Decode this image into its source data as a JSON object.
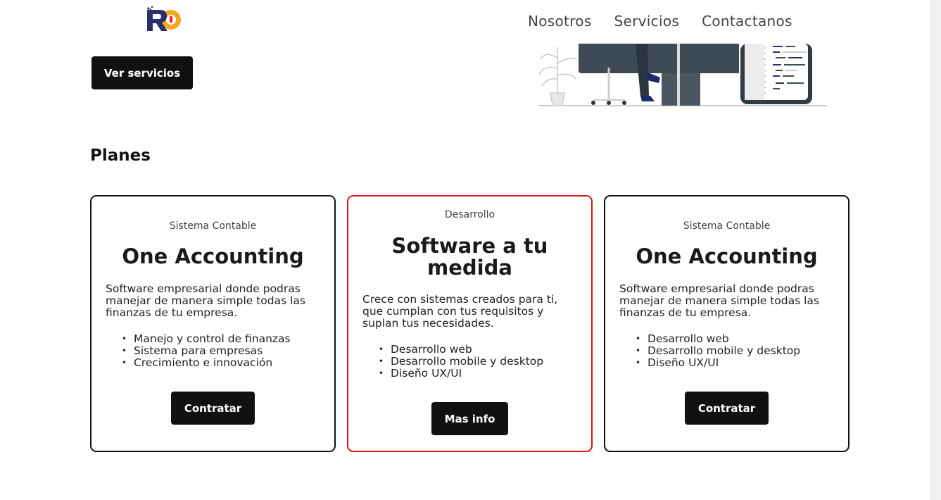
{
  "brand": {
    "logo_text": "RD",
    "colors": {
      "navy": "#2b2f6b",
      "orange": "#f5a623",
      "accent_red": "#dd1111"
    }
  },
  "nav": {
    "items": [
      "Nosotros",
      "Servicios",
      "Contactanos"
    ]
  },
  "hero": {
    "cta_label": "Ver servicios",
    "illustration_icon": "developer-at-desk-illustration"
  },
  "plans": {
    "title": "Planes",
    "cards": [
      {
        "kicker": "Sistema Contable",
        "title": "One Accounting",
        "description": "Software empresarial donde podras manejar de manera simple todas las finanzas de tu empresa.",
        "features": [
          "Manejo y control de finanzas",
          "Sistema para empresas",
          "Crecimiento e innovación"
        ],
        "button": "Contratar"
      },
      {
        "kicker": "Desarrollo",
        "title": "Software a tu medida",
        "description": "Crece con sistemas creados para ti, que cumplan con tus requisitos y suplan tus necesidades.",
        "features": [
          "Desarrollo web",
          "Desarrollo mobile y desktop",
          "Diseño UX/UI"
        ],
        "button": "Mas info"
      },
      {
        "kicker": "Sistema Contable",
        "title": "One Accounting",
        "description": "Software empresarial donde podras manejar de manera simple todas las finanzas de tu empresa.",
        "features": [
          "Desarrollo web",
          "Desarrollo mobile y desktop",
          "Diseño UX/UI"
        ],
        "button": "Contratar"
      }
    ]
  }
}
